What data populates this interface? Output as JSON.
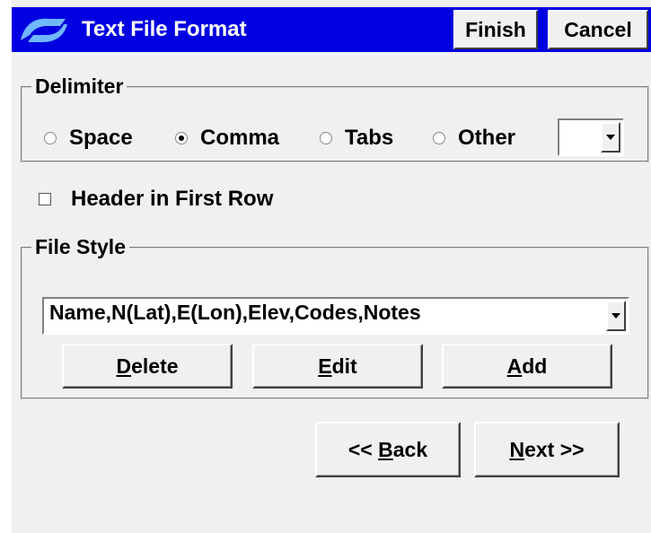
{
  "window": {
    "title": "Text File Format",
    "finish_label": "Finish",
    "cancel_label": "Cancel",
    "title_bar_color": "#0000e0"
  },
  "delimiter": {
    "legend": "Delimiter",
    "options": [
      "Space",
      "Comma",
      "Tabs",
      "Other"
    ],
    "selected": "Comma",
    "other_value": ""
  },
  "header_checkbox": {
    "label": "Header in First Row",
    "checked": false
  },
  "file_style": {
    "legend": "File Style",
    "selected": "Name,N(Lat),E(Lon),Elev,Codes,Notes",
    "delete": {
      "mnemonic": "D",
      "rest": "elete"
    },
    "edit": {
      "mnemonic": "E",
      "rest": "dit"
    },
    "add": {
      "mnemonic": "A",
      "rest": "dd"
    }
  },
  "nav": {
    "back": {
      "prefix": "<< ",
      "mnemonic": "B",
      "rest": "ack"
    },
    "next": {
      "mnemonic": "N",
      "rest": "ext >>"
    }
  }
}
